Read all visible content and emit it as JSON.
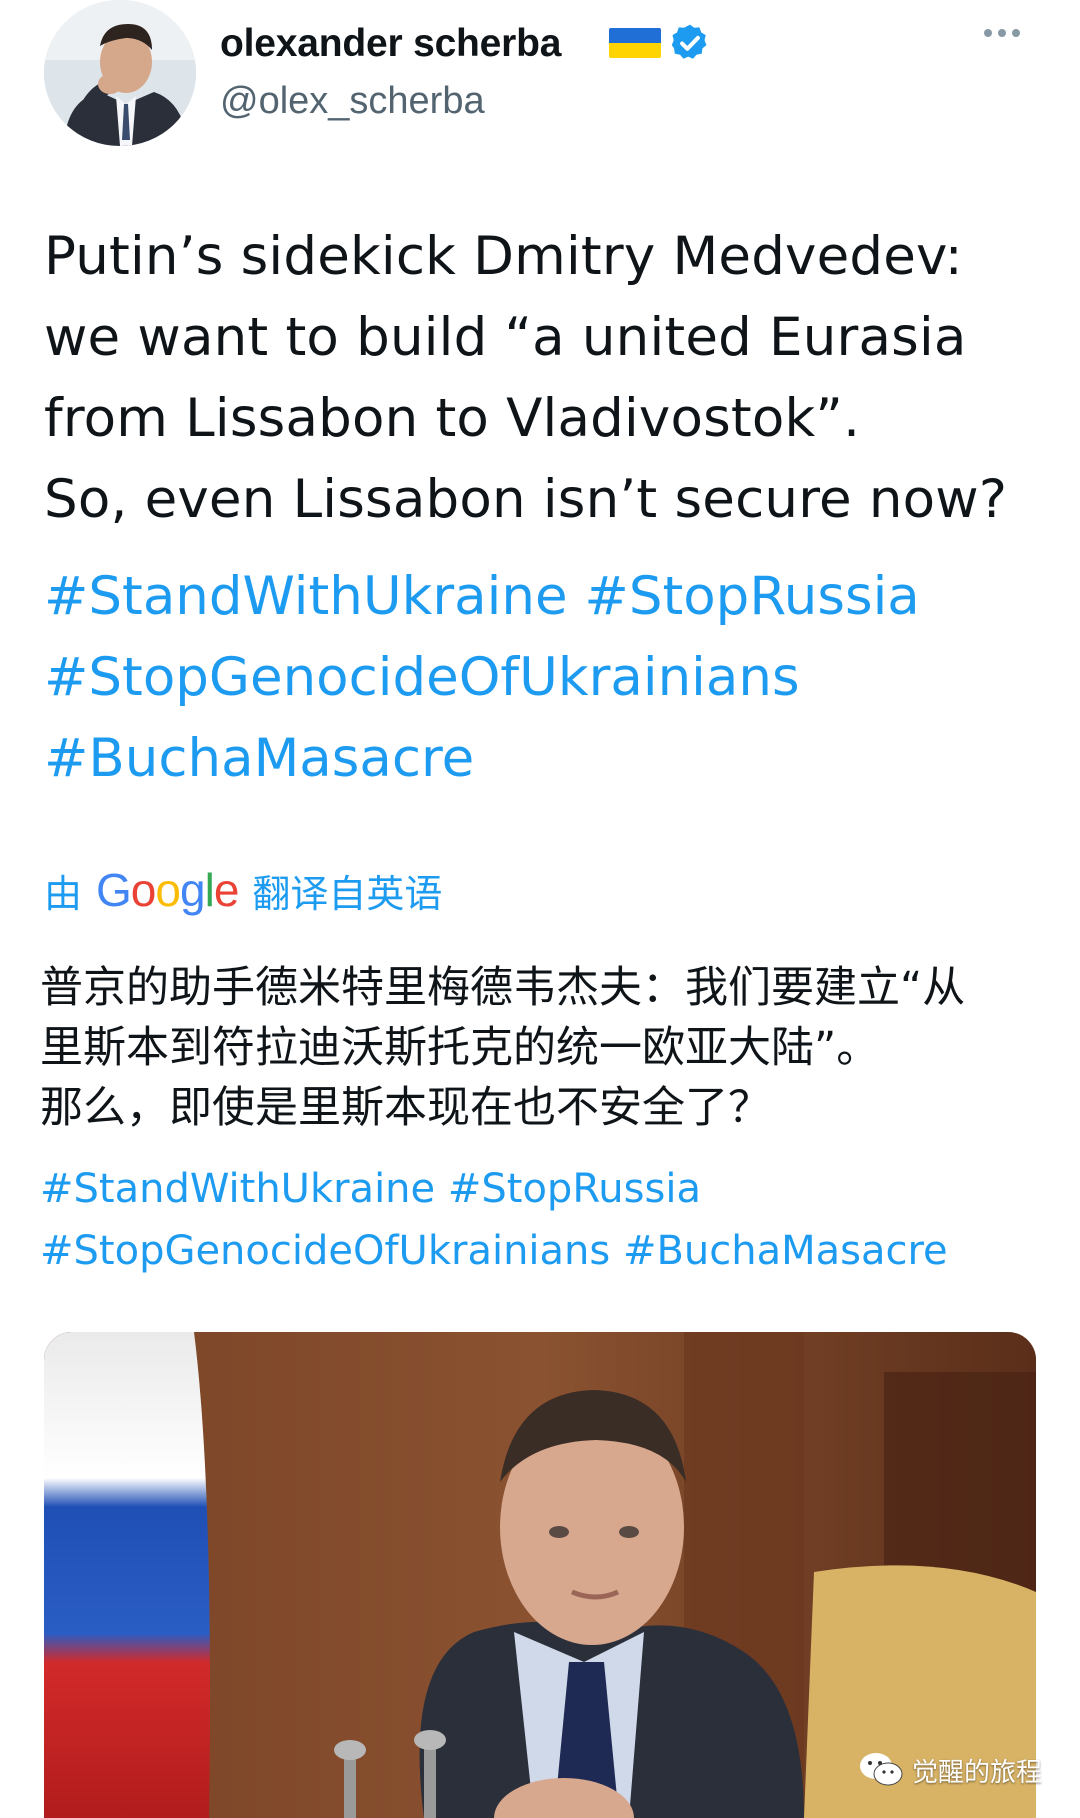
{
  "author": {
    "display_name": "olexander scherba",
    "handle": "@olex_scherba",
    "flag": "Ukraine flag",
    "verified": true
  },
  "tweet": {
    "text_lines": [
      "Putin’s sidekick Dmitry Medvedev:",
      "we want to build “a united Eurasia",
      "from Lissabon to Vladivostok”.",
      "So, even Lissabon isn’t secure now?"
    ],
    "hashtag_lines": [
      [
        "#StandWithUkraine",
        "#StopRussia"
      ],
      [
        "#StopGenocideOfUkrainians"
      ],
      [
        "#BuchaMasacre"
      ]
    ]
  },
  "translation": {
    "prefix": "由",
    "provider": "Google",
    "suffix": "翻译自英语",
    "text_lines": [
      "普京的助手德米特里梅德韦杰夫：我们要建立“从",
      "里斯本到符拉迪沃斯托克的统一欧亚大陆”。",
      "那么，即使是里斯本现在也不安全了？"
    ],
    "hashtag_lines": [
      [
        " #StandWithUkraine",
        "#StopRussia"
      ],
      [
        "#StopGenocideOfUkrainians",
        "#BuchaMasacre"
      ]
    ]
  },
  "watermark": {
    "text": "觉醒的旅程"
  },
  "colors": {
    "link": "#1d9bf0",
    "text": "#0f1419",
    "muted": "#536471"
  },
  "icons": {
    "verified": "verified-badge-icon",
    "more": "more-options-icon",
    "watermark": "wechat-icon"
  }
}
